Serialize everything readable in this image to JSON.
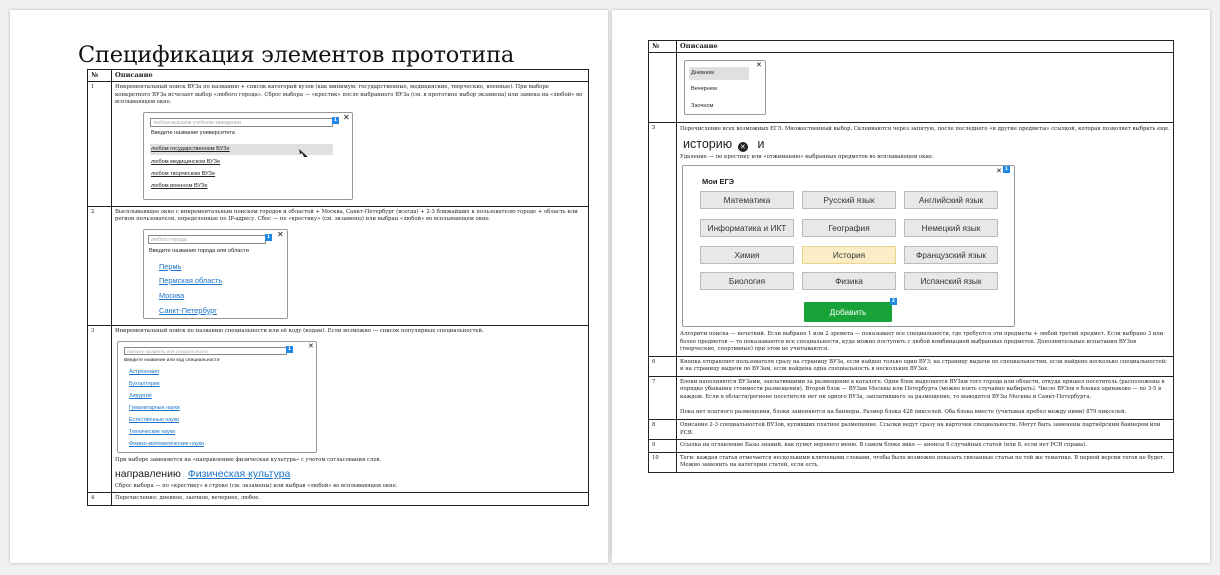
{
  "left_page": {
    "title": "Спецификация элементов прототипа",
    "table_header": {
      "num": "№",
      "desc": "Описание"
    },
    "row1": {
      "num": "1",
      "text": "Инкрементальный поиск ВУЗа по названию + список категорий вузов (как минимум: государственные, медицинские, творческие, военные). При выборе конкретного ВУЗа исчезает выбор «любого города». Сброс выбора — «крестик» после выбранного ВУЗа (см. в прототипе выбор экзамена) или замена на «любой» во всплывающем окне.",
      "widget": {
        "input_placeholder": "любом высшем учебном заведении",
        "badge": "1",
        "hint": "Введите название университета",
        "items": [
          "любом государственном ВУЗе",
          "любом медицинском ВУЗе",
          "любом творческом ВУЗе",
          "любом военном ВУЗе"
        ]
      }
    },
    "row2": {
      "num": "2",
      "text": "Высплывающее окно с инкрементальным поиском городов и областей + Москва, Санкт-Петербург (всегда) + 2-3 ближайших к пользователю городе + область или регион пользователя, определенные по IP-адресу. Сбос — по «крестику» (см. экзамены) или выбран «любой» во всплывающем окне.",
      "widget": {
        "input_placeholder": "любого города",
        "badge": "1",
        "hint": "Введите название города или области",
        "items": [
          "Пермь",
          "Пермская область",
          "Москва",
          "Санкт-Петербург"
        ]
      }
    },
    "row3": {
      "num": "3",
      "text": "Инкрементальный поиск по названию специальности или её коду (кодам). Если возможно — список популярных специальностей.",
      "widget": {
        "input_placeholder": "любому профилю или специальности",
        "badge": "1",
        "hint": "Введите название или код специальности",
        "items": [
          "Астрономия",
          "Бухгалтерия",
          "Хирургия",
          "Гуманитарные науки",
          "Естественные науки",
          "Технические науки",
          "Физико-математические науки"
        ]
      },
      "after_text": "При выборе заменяется на «направлению физическая культура» с учетом согласования слов.",
      "example_plain": "направлению",
      "example_link": "Физическая культура",
      "reset_text": "Сброс выбора — по «крестику» в строке (см. экзамены) или выбрав «любой» во всплывающем окне."
    },
    "row4": {
      "num": "4",
      "text": "Перечисление: дневное, заочное, вечернее, любое."
    }
  },
  "right_page": {
    "table_header": {
      "num": "№",
      "desc": "Описание"
    },
    "forms": [
      "Дневном",
      "Вечернем",
      "Заочном"
    ],
    "row5": {
      "num": "5",
      "text": "Перечисление всех возможных ЕГЭ. Множественный выбор. Склеиваются через запятую, после последнего «и другие предметы» ссылкой, которая позволяет выбрать еще.",
      "example_word": "историю",
      "example_tail": "и",
      "remove_text": "Удаление — по крестику или «отжиманию» выбранных предметов во всплывающем окне.",
      "modal_title": "Мои ЕГЭ",
      "modal_badge": "1",
      "exams": [
        "Математика",
        "Русский язык",
        "Английский язык",
        "Информатика и ИКТ",
        "География",
        "Немецкий язык",
        "Химия",
        "История",
        "Французский язык",
        "Биология",
        "Физика",
        "Испанский язык"
      ],
      "selected_exam": "История",
      "add_button": "Добавить",
      "add_badge": "2",
      "algo_text": "Алгоритм поиска — нечеткий. Если выбрано 1 или 2 эремета — показывает все специальности, где требуется эти предметы + любой третий предмет. Если выбрано 3 или более предметов — то показываются все специальности, куда можно поступить с любой комбинацией выбранных предметов. Дополнительные испытания ВУЗов (творческие, спортивные) при этом не учитываются."
    },
    "row6": {
      "num": "6",
      "text": "Кнопка отправляет пользователя сразу на страницу ВУЗа, если найден только один ВУЗ; на страницу выдачи по специальностям, если найдено несколько специальностей; и на страницу выдачи по ВУЗам, если найдена одна специальность в нескольких ВУЗах."
    },
    "row7": {
      "num": "7",
      "text": "Блоки наполняются ВУЗами, заплатившими за размещение в каталоге. Один блок выделяется ВУЗам того города или области, откуда пришел посетитель (расположены в порядке убывания стоимости размещения). Второй блок — ВУЗам Москвы или Петербурга (можно взять случайно выбирать). Число ВУЗов в блоках одинаково — по 3-5 в каждом. Если в области/регионе посетителя нет ни одного ВУЗа, заплатившего за размещение, то выводятся ВУЗы Москвы и Санкт-Петербурга.",
      "text2": "Пока нет платного размещения, блоки заменяются на баннеры. Размер блока 428 пикселей. Оба блока вместе (учитывая пребел между ними) 879 пикселей."
    },
    "row8": {
      "num": "8",
      "text": "Описание 2-3 специальностей ВУЗов, купивших платное размещение. Ссылки ведут сразу на карточки специальности. Могут быть заменены партнёрским баннером или РСЯ."
    },
    "row9": {
      "num": "9",
      "text": "Ссылка на оглавление Базы знаний, как пункт верхнего меню. В самом блоке вике — анонсы 6 случайных статей (или 8, если нет РСЯ справа)."
    },
    "row10": {
      "num": "10",
      "text": "Теги: каждая статья отмечается несколькими ключевыми словами, чтобы было возможно показать связанные статьи по той же тематике. В первой версии тегов не будет. Можно заменить на категории статей, если есть."
    }
  }
}
